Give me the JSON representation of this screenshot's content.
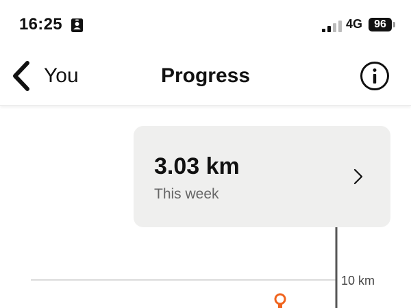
{
  "status_bar": {
    "time": "16:25",
    "network": "4G",
    "battery": "96"
  },
  "nav": {
    "back_label": "You",
    "title": "Progress",
    "info_icon": "info-icon"
  },
  "summary_card": {
    "value": "3.03 km",
    "subtitle": "This week"
  },
  "chart": {
    "gridline_label": "10 km",
    "accent_color": "#f0641e"
  }
}
